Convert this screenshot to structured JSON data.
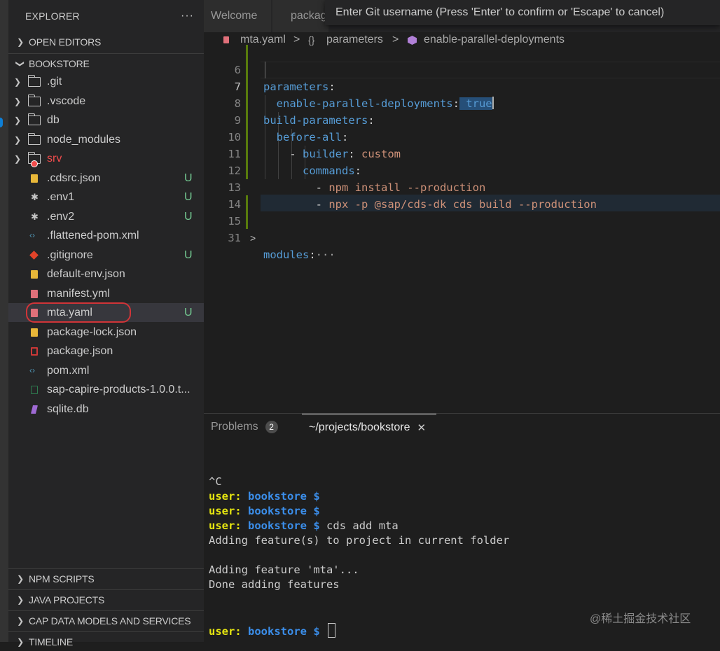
{
  "sidebar": {
    "title": "EXPLORER",
    "more": "···",
    "sections": {
      "open_editors": "OPEN EDITORS",
      "bookstore": "BOOKSTORE",
      "npm_scripts": "NPM SCRIPTS",
      "java_projects": "JAVA PROJECTS",
      "cap_data_models": "CAP DATA MODELS AND SERVICES",
      "timeline": "TIMELINE"
    },
    "items": [
      {
        "label": ".git",
        "badge": ""
      },
      {
        "label": ".vscode",
        "badge": ""
      },
      {
        "label": "db",
        "badge": ""
      },
      {
        "label": "node_modules",
        "badge": ""
      },
      {
        "label": "srv",
        "badge": ""
      },
      {
        "label": ".cdsrc.json",
        "badge": "U"
      },
      {
        "label": ".env1",
        "badge": "U"
      },
      {
        "label": ".env2",
        "badge": "U"
      },
      {
        "label": ".flattened-pom.xml",
        "badge": ""
      },
      {
        "label": ".gitignore",
        "badge": "U"
      },
      {
        "label": "default-env.json",
        "badge": ""
      },
      {
        "label": "manifest.yml",
        "badge": ""
      },
      {
        "label": "mta.yaml",
        "badge": "U"
      },
      {
        "label": "package-lock.json",
        "badge": ""
      },
      {
        "label": "package.json",
        "badge": ""
      },
      {
        "label": "pom.xml",
        "badge": ""
      },
      {
        "label": "sap-capire-products-1.0.0.t...",
        "badge": ""
      },
      {
        "label": "sqlite.db",
        "badge": ""
      }
    ]
  },
  "editor": {
    "tabs": [
      "Welcome",
      "packag"
    ],
    "quick_input": "Enter Git username (Press 'Enter' to confirm or 'Escape' to cancel)",
    "breadcrumb": {
      "file": "mta.yaml",
      "sep": ">",
      "obj_icon": "{}",
      "obj": "parameters",
      "leaf": "enable-parallel-deployments"
    },
    "lines": [
      {
        "num": "6",
        "indent": "",
        "key": "parameters",
        "colon": ":",
        "value": ""
      },
      {
        "num": "7",
        "indent": "  ",
        "key": "enable-parallel-deployments",
        "colon": ":",
        "value": " true"
      },
      {
        "num": "8",
        "indent": "",
        "key": "build-parameters",
        "colon": ":",
        "value": ""
      },
      {
        "num": "9",
        "indent": "  ",
        "key": "before-all",
        "colon": ":",
        "value": ""
      },
      {
        "num": "10",
        "indent": "    - ",
        "key": "builder",
        "colon": ":",
        "value": " custom"
      },
      {
        "num": "11",
        "indent": "      ",
        "key": "commands",
        "colon": ":",
        "value": ""
      },
      {
        "num": "12",
        "indent": "        - ",
        "key": "",
        "colon": "",
        "value": "npm install --production"
      },
      {
        "num": "13",
        "indent": "        - ",
        "key": "",
        "colon": "",
        "value": "npx -p @sap/cds-dk cds build --production"
      },
      {
        "num": "14",
        "indent": "",
        "key": "",
        "colon": "",
        "value": ""
      },
      {
        "num": "15",
        "indent": "",
        "key": "modules",
        "colon": ":",
        "value": "···"
      },
      {
        "num": "31",
        "indent": "",
        "key": "",
        "colon": "",
        "value": ""
      }
    ],
    "fold_icon": ">"
  },
  "panel": {
    "problems_label": "Problems",
    "problems_count": "2",
    "terminal_label": "~/projects/bookstore",
    "close": "✕",
    "terminal": {
      "ctrl_c": "^C",
      "user": "user:",
      "path": "bookstore",
      "prompt": "$",
      "cmd": "cds add mta",
      "out1": "Adding feature(s) to project in current folder",
      "out2": "Adding feature 'mta'...",
      "out3": "Done adding features"
    }
  },
  "watermark": "@稀土掘金技术社区",
  "colors": {
    "key": "#569cd6",
    "string": "#ce9178",
    "untracked": "#73c991",
    "terminal_user": "#e5e510",
    "terminal_path": "#3b8eea"
  }
}
